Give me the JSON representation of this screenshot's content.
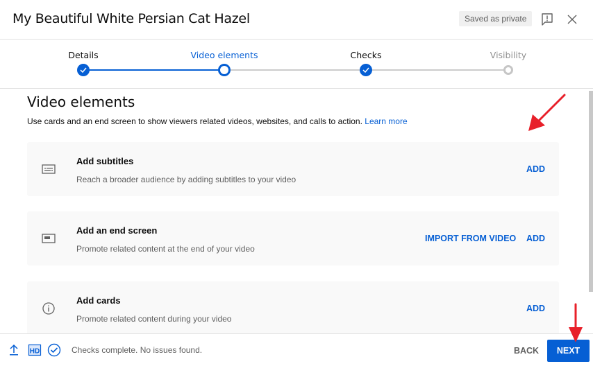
{
  "header": {
    "title": "My Beautiful White Persian Cat Hazel",
    "saved_badge": "Saved as private",
    "feedback_icon": "feedback-icon",
    "close_icon": "close-icon"
  },
  "stepper": {
    "steps": [
      {
        "label": "Details",
        "state": "done"
      },
      {
        "label": "Video elements",
        "state": "current"
      },
      {
        "label": "Checks",
        "state": "done"
      },
      {
        "label": "Visibility",
        "state": "todo"
      }
    ]
  },
  "content": {
    "title": "Video elements",
    "description": "Use cards and an end screen to show viewers related videos, websites, and calls to action.",
    "learn_more": "Learn more",
    "cards": [
      {
        "icon": "subtitles-icon",
        "title": "Add subtitles",
        "description": "Reach a broader audience by adding subtitles to your video",
        "actions": [
          "ADD"
        ]
      },
      {
        "icon": "end-screen-icon",
        "title": "Add an end screen",
        "description": "Promote related content at the end of your video",
        "actions": [
          "IMPORT FROM VIDEO",
          "ADD"
        ]
      },
      {
        "icon": "info-icon",
        "title": "Add cards",
        "description": "Promote related content during your video",
        "actions": [
          "ADD"
        ]
      }
    ]
  },
  "footer": {
    "icons": [
      "upload-icon",
      "hd-icon",
      "check-circle-icon"
    ],
    "status": "Checks complete. No issues found.",
    "back_label": "BACK",
    "next_label": "NEXT"
  },
  "colors": {
    "accent": "#065fd4",
    "annotation_arrow": "#e8202a",
    "card_bg": "#f9f9f9",
    "secondary_text": "#606060"
  }
}
